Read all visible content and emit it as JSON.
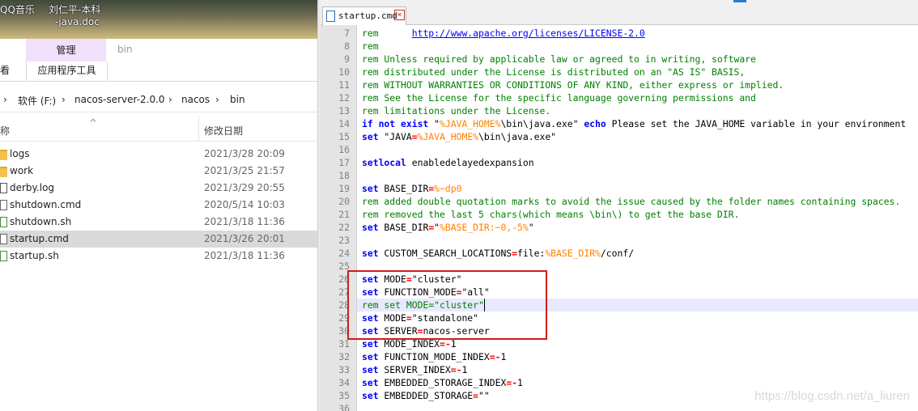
{
  "desktop": {
    "items": [
      {
        "label": "QQ音乐"
      },
      {
        "label": "刘仁平-本科"
      },
      {
        "label": "-java.doc"
      }
    ]
  },
  "explorer": {
    "ribbon": {
      "context_header": "管理",
      "context_title": "bin",
      "tab_view": "查看",
      "tab_app_tools": "应用程序工具"
    },
    "address": {
      "arrow": "›",
      "segments": [
        "软件 (F:)",
        "nacos-server-2.0.0",
        "nacos",
        "bin"
      ],
      "separator": "›"
    },
    "columns": {
      "name": "名称",
      "sort_indicator": "^",
      "modified": "修改日期"
    },
    "files": [
      {
        "name": "logs",
        "modified": "2021/3/28 20:09",
        "icon": "folder-icon",
        "selected": false
      },
      {
        "name": "work",
        "modified": "2021/3/25 21:57",
        "icon": "folder-icon",
        "selected": false
      },
      {
        "name": "derby.log",
        "modified": "2021/3/29 20:55",
        "icon": "log-file-icon",
        "selected": false
      },
      {
        "name": "shutdown.cmd",
        "modified": "2020/5/14 10:03",
        "icon": "cmd-file-icon",
        "selected": false
      },
      {
        "name": "shutdown.sh",
        "modified": "2021/3/18 11:36",
        "icon": "sh-file-icon",
        "selected": false
      },
      {
        "name": "startup.cmd",
        "modified": "2021/3/26 20:01",
        "icon": "cmd-file-icon",
        "selected": true
      },
      {
        "name": "startup.sh",
        "modified": "2021/3/18 11:36",
        "icon": "sh-file-icon",
        "selected": false
      }
    ]
  },
  "editor": {
    "tab": {
      "filename": "startup.cmd",
      "close": "×"
    },
    "current_line": 28,
    "highlighted_lines": [
      26,
      27,
      28,
      29,
      30
    ],
    "lines": [
      {
        "n": 7,
        "tokens": [
          [
            "rem",
            "rem"
          ],
          [
            "t",
            "      "
          ],
          [
            "url",
            "http://www.apache.org/licenses/LICENSE-2.0"
          ]
        ]
      },
      {
        "n": 8,
        "tokens": [
          [
            "rem",
            "rem"
          ]
        ]
      },
      {
        "n": 9,
        "tokens": [
          [
            "rem",
            "rem Unless required by applicable law or agreed to in writing, software"
          ]
        ]
      },
      {
        "n": 10,
        "tokens": [
          [
            "rem",
            "rem distributed under the License is distributed on an \"AS IS\" BASIS,"
          ]
        ]
      },
      {
        "n": 11,
        "tokens": [
          [
            "rem",
            "rem WITHOUT WARRANTIES OR CONDITIONS OF ANY KIND, either express or implied."
          ]
        ]
      },
      {
        "n": 12,
        "tokens": [
          [
            "rem",
            "rem See the License for the specific language governing permissions and"
          ]
        ]
      },
      {
        "n": 13,
        "tokens": [
          [
            "rem",
            "rem limitations under the License."
          ]
        ]
      },
      {
        "n": 14,
        "tokens": [
          [
            "kw",
            "if not exist"
          ],
          [
            "t",
            " \""
          ],
          [
            "var",
            "%JAVA_HOME%"
          ],
          [
            "t",
            "\\bin\\java.exe\" "
          ],
          [
            "kw",
            "echo"
          ],
          [
            "t",
            " Please set the JAVA_HOME variable in your environment"
          ]
        ]
      },
      {
        "n": 15,
        "tokens": [
          [
            "kw",
            "set"
          ],
          [
            "t",
            " \"JAVA"
          ],
          [
            "op",
            "="
          ],
          [
            "var",
            "%JAVA_HOME%"
          ],
          [
            "t",
            "\\bin\\java.exe\""
          ]
        ]
      },
      {
        "n": 16,
        "tokens": []
      },
      {
        "n": 17,
        "tokens": [
          [
            "kw",
            "setlocal"
          ],
          [
            "t",
            " enabledelayedexpansion"
          ]
        ]
      },
      {
        "n": 18,
        "tokens": []
      },
      {
        "n": 19,
        "tokens": [
          [
            "kw",
            "set"
          ],
          [
            "t",
            " BASE_DIR"
          ],
          [
            "op",
            "="
          ],
          [
            "var",
            "%~dp0"
          ]
        ]
      },
      {
        "n": 20,
        "tokens": [
          [
            "rem",
            "rem added double quotation marks to avoid the issue caused by the folder names containing spaces."
          ]
        ]
      },
      {
        "n": 21,
        "tokens": [
          [
            "rem",
            "rem removed the last 5 chars(which means \\bin\\) to get the base DIR."
          ]
        ]
      },
      {
        "n": 22,
        "tokens": [
          [
            "kw",
            "set"
          ],
          [
            "t",
            " BASE_DIR"
          ],
          [
            "op",
            "="
          ],
          [
            "t",
            "\""
          ],
          [
            "var",
            "%BASE_DIR:~0,-5%"
          ],
          [
            "t",
            "\""
          ]
        ]
      },
      {
        "n": 23,
        "tokens": []
      },
      {
        "n": 24,
        "tokens": [
          [
            "kw",
            "set"
          ],
          [
            "t",
            " CUSTOM_SEARCH_LOCATIONS"
          ],
          [
            "op",
            "="
          ],
          [
            "t",
            "file:"
          ],
          [
            "var",
            "%BASE_DIR%"
          ],
          [
            "t",
            "/conf/"
          ]
        ]
      },
      {
        "n": 25,
        "tokens": []
      },
      {
        "n": 26,
        "tokens": [
          [
            "kw",
            "set"
          ],
          [
            "t",
            " MODE"
          ],
          [
            "op",
            "="
          ],
          [
            "t",
            "\"cluster\""
          ]
        ]
      },
      {
        "n": 27,
        "tokens": [
          [
            "kw",
            "set"
          ],
          [
            "t",
            " FUNCTION_MODE"
          ],
          [
            "op",
            "="
          ],
          [
            "t",
            "\"all\""
          ]
        ]
      },
      {
        "n": 28,
        "tokens": [
          [
            "rem",
            "rem set MODE=\"cluster\""
          ]
        ]
      },
      {
        "n": 29,
        "tokens": [
          [
            "kw",
            "set"
          ],
          [
            "t",
            " MODE"
          ],
          [
            "op",
            "="
          ],
          [
            "t",
            "\"standalone\""
          ]
        ]
      },
      {
        "n": 30,
        "tokens": [
          [
            "kw",
            "set"
          ],
          [
            "t",
            " SERVER"
          ],
          [
            "op",
            "="
          ],
          [
            "t",
            "nacos-server"
          ]
        ]
      },
      {
        "n": 31,
        "tokens": [
          [
            "kw",
            "set"
          ],
          [
            "t",
            " MODE_INDEX"
          ],
          [
            "op",
            "=-"
          ],
          [
            "t",
            "1"
          ]
        ]
      },
      {
        "n": 32,
        "tokens": [
          [
            "kw",
            "set"
          ],
          [
            "t",
            " FUNCTION_MODE_INDEX"
          ],
          [
            "op",
            "=-"
          ],
          [
            "t",
            "1"
          ]
        ]
      },
      {
        "n": 33,
        "tokens": [
          [
            "kw",
            "set"
          ],
          [
            "t",
            " SERVER_INDEX"
          ],
          [
            "op",
            "=-"
          ],
          [
            "t",
            "1"
          ]
        ]
      },
      {
        "n": 34,
        "tokens": [
          [
            "kw",
            "set"
          ],
          [
            "t",
            " EMBEDDED_STORAGE_INDEX"
          ],
          [
            "op",
            "=-"
          ],
          [
            "t",
            "1"
          ]
        ]
      },
      {
        "n": 35,
        "tokens": [
          [
            "kw",
            "set"
          ],
          [
            "t",
            " EMBEDDED_STORAGE"
          ],
          [
            "op",
            "="
          ],
          [
            "t",
            "\"\""
          ]
        ]
      },
      {
        "n": 36,
        "tokens": []
      }
    ],
    "watermark": "https://blog.csdn.net/a_liuren"
  },
  "colors": {
    "rem": "#008000",
    "keyword": "#0000ff",
    "variable": "#ff8000",
    "operator": "#ff0000",
    "url": "#0000ff",
    "text": "#000000",
    "annotation_box": "#d01b1b",
    "selection": "#d9d9d9",
    "context_tab": "#f1e0fb"
  }
}
